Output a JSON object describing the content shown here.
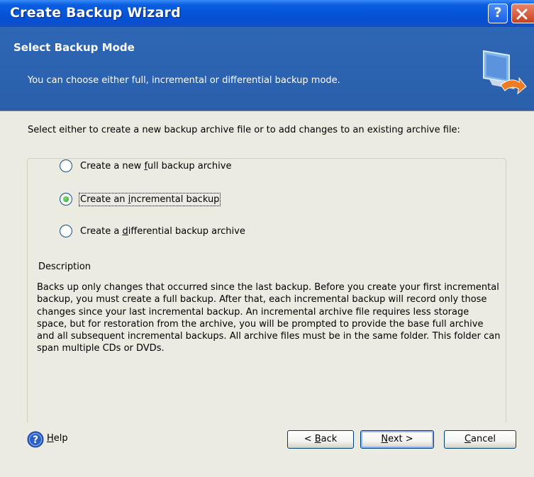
{
  "window": {
    "title": "Create Backup Wizard",
    "help_button": "?",
    "close_icon": "close-icon"
  },
  "header": {
    "title": "Select Backup Mode",
    "subtitle": "You can choose either full, incremental or differential backup mode.",
    "icon": "backup-computer-icon"
  },
  "content": {
    "instruction": "Select either to create a new backup archive file or to add changes to an existing archive file:",
    "options": [
      {
        "label": "Create a new full backup archive",
        "prefix": "Create a new ",
        "accel": "f",
        "suffix": "ull backup archive",
        "selected": false
      },
      {
        "label": "Create an incremental backup",
        "prefix": "Create an ",
        "accel": "i",
        "suffix": "ncremental backup",
        "selected": true
      },
      {
        "label": "Create a differential backup archive",
        "prefix": "Create a ",
        "accel": "d",
        "suffix": "ifferential backup archive",
        "selected": false
      }
    ],
    "description_legend": "Description",
    "description": "Backs up only changes that occurred since the last backup. Before you create your first incremental backup, you must create a full backup. After that, each incremental backup will record only those changes since your last incremental backup. An incremental archive file requires less storage space, but for restoration from the archive, you will be prompted to provide the base full archive and all subsequent incremental backups. All archive files must be in the same folder. This folder can span multiple CDs or DVDs."
  },
  "footer": {
    "help": {
      "accel": "H",
      "rest": "elp"
    },
    "back": {
      "pre": "< ",
      "accel": "B",
      "rest": "ack"
    },
    "next": {
      "accel": "N",
      "rest": "ext >"
    },
    "cancel": {
      "accel": "C",
      "rest": "ancel"
    }
  },
  "colors": {
    "titlebar": "#0553d6",
    "header": "#2e67b6",
    "body": "#ecebe2",
    "radio_selected": "#21a121"
  }
}
